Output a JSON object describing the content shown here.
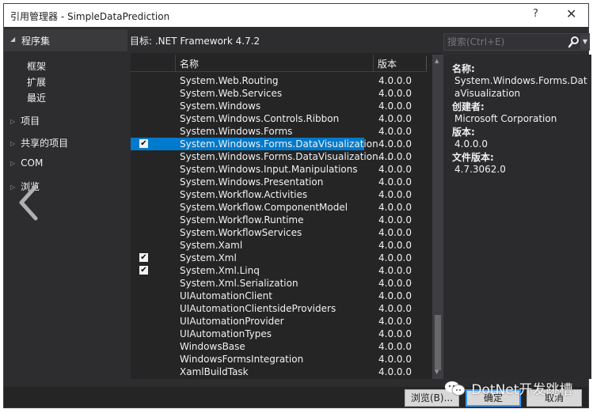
{
  "window": {
    "title": "引用管理器 - SimpleDataPrediction",
    "help_label": "?",
    "close_label": "✕"
  },
  "left_panel": {
    "header": "程序集",
    "sub_items": [
      "框架",
      "扩展",
      "最近"
    ],
    "groups": [
      "项目",
      "共享的项目",
      "COM",
      "浏览"
    ]
  },
  "target": {
    "label": "目标: .NET Framework 4.7.2"
  },
  "search": {
    "placeholder": "搜索(Ctrl+E)",
    "value": ""
  },
  "list": {
    "columns": {
      "name": "名称",
      "version": "版本"
    },
    "rows": [
      {
        "name": "System.Web.Routing",
        "version": "4.0.0.0",
        "checked": false,
        "selected": false
      },
      {
        "name": "System.Web.Services",
        "version": "4.0.0.0",
        "checked": false,
        "selected": false
      },
      {
        "name": "System.Windows",
        "version": "4.0.0.0",
        "checked": false,
        "selected": false
      },
      {
        "name": "System.Windows.Controls.Ribbon",
        "version": "4.0.0.0",
        "checked": false,
        "selected": false
      },
      {
        "name": "System.Windows.Forms",
        "version": "4.0.0.0",
        "checked": false,
        "selected": false
      },
      {
        "name": "System.Windows.Forms.DataVisualization",
        "version": "4.0.0.0",
        "checked": true,
        "selected": true
      },
      {
        "name": "System.Windows.Forms.DataVisualization....",
        "version": "4.0.0.0",
        "checked": false,
        "selected": false
      },
      {
        "name": "System.Windows.Input.Manipulations",
        "version": "4.0.0.0",
        "checked": false,
        "selected": false
      },
      {
        "name": "System.Windows.Presentation",
        "version": "4.0.0.0",
        "checked": false,
        "selected": false
      },
      {
        "name": "System.Workflow.Activities",
        "version": "4.0.0.0",
        "checked": false,
        "selected": false
      },
      {
        "name": "System.Workflow.ComponentModel",
        "version": "4.0.0.0",
        "checked": false,
        "selected": false
      },
      {
        "name": "System.Workflow.Runtime",
        "version": "4.0.0.0",
        "checked": false,
        "selected": false
      },
      {
        "name": "System.WorkflowServices",
        "version": "4.0.0.0",
        "checked": false,
        "selected": false
      },
      {
        "name": "System.Xaml",
        "version": "4.0.0.0",
        "checked": false,
        "selected": false
      },
      {
        "name": "System.Xml",
        "version": "4.0.0.0",
        "checked": true,
        "selected": false
      },
      {
        "name": "System.Xml.Linq",
        "version": "4.0.0.0",
        "checked": true,
        "selected": false
      },
      {
        "name": "System.Xml.Serialization",
        "version": "4.0.0.0",
        "checked": false,
        "selected": false
      },
      {
        "name": "UIAutomationClient",
        "version": "4.0.0.0",
        "checked": false,
        "selected": false
      },
      {
        "name": "UIAutomationClientsideProviders",
        "version": "4.0.0.0",
        "checked": false,
        "selected": false
      },
      {
        "name": "UIAutomationProvider",
        "version": "4.0.0.0",
        "checked": false,
        "selected": false
      },
      {
        "name": "UIAutomationTypes",
        "version": "4.0.0.0",
        "checked": false,
        "selected": false
      },
      {
        "name": "WindowsBase",
        "version": "4.0.0.0",
        "checked": false,
        "selected": false
      },
      {
        "name": "WindowsFormsIntegration",
        "version": "4.0.0.0",
        "checked": false,
        "selected": false
      },
      {
        "name": "XamlBuildTask",
        "version": "4.0.0.0",
        "checked": false,
        "selected": false
      }
    ],
    "check_glyph": "✔"
  },
  "details": {
    "name_label": "名称:",
    "name_value": "System.Windows.Forms.DataVisualization",
    "creator_label": "创建者:",
    "creator_value": "Microsoft Corporation",
    "version_label": "版本:",
    "version_value": "4.0.0.0",
    "file_version_label": "文件版本:",
    "file_version_value": "4.7.3062.0"
  },
  "buttons": {
    "browse": "浏览(B)...",
    "ok": "确定",
    "cancel": "取消"
  },
  "watermark": {
    "text": "DotNet开发跳槽"
  },
  "colors": {
    "selection": "#007acc",
    "background": "#2d2d30",
    "list_background": "#252526",
    "ok_border": "#3399ff"
  }
}
